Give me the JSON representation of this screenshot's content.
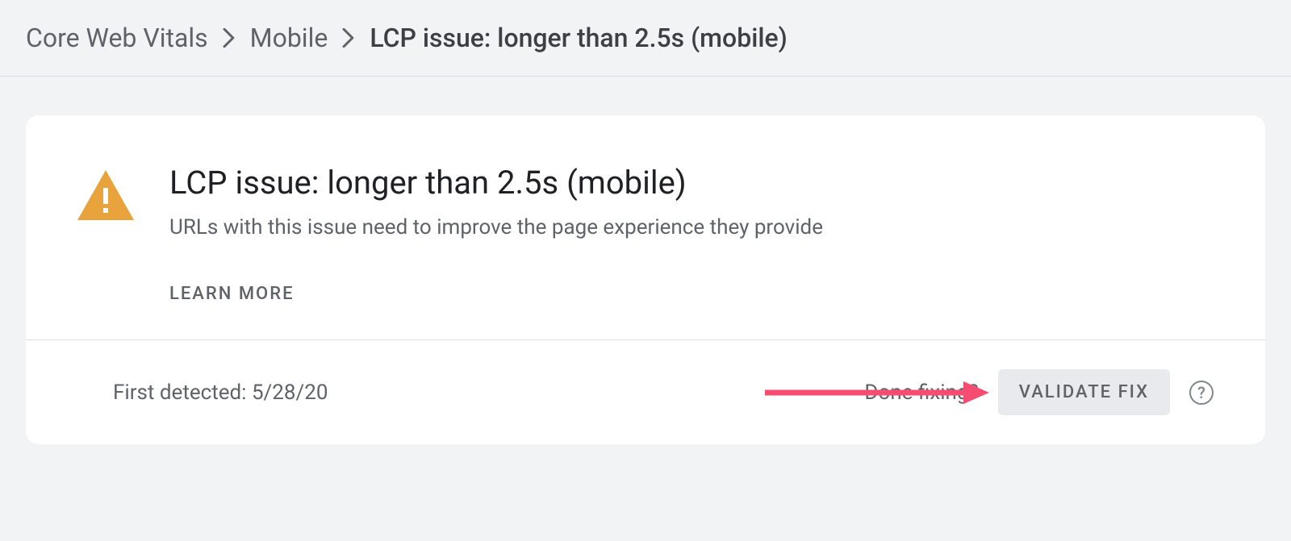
{
  "breadcrumb": {
    "items": [
      "Core Web Vitals",
      "Mobile",
      "LCP issue: longer than 2.5s (mobile)"
    ]
  },
  "issue": {
    "title": "LCP issue: longer than 2.5s (mobile)",
    "subtitle": "URLs with this issue need to improve the page experience they provide",
    "learn_more_label": "LEARN MORE"
  },
  "detection": {
    "first_detected_label": "First detected:",
    "first_detected_date": "5/28/20"
  },
  "actions": {
    "done_fixing_label": "Done fixing?",
    "validate_label": "VALIDATE FIX",
    "help_label": "?"
  },
  "colors": {
    "warning": "#e8a33d",
    "annotation": "#f64c72"
  }
}
